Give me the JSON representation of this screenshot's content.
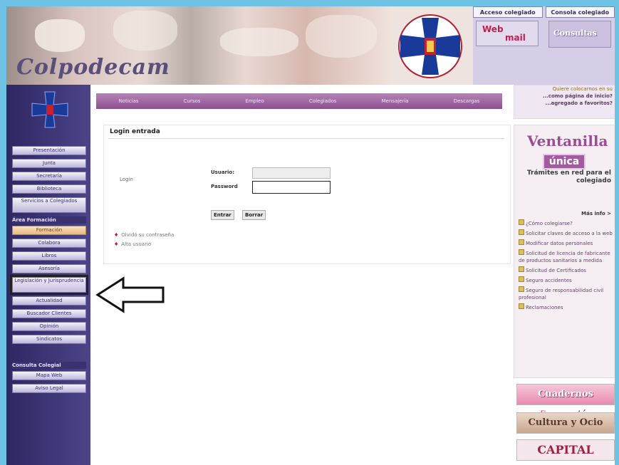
{
  "header": {
    "logo_text": "Colpodecam",
    "access_links": [
      "Acceso colegiado",
      "Consola colegiado"
    ],
    "webmail_label_1": "Web",
    "webmail_label_2": "mail",
    "consulta_label": "Consultas"
  },
  "sidebar": {
    "items": [
      "Presentación",
      "Junta",
      "Secretaría",
      "Biblioteca",
      "Servicios a Colegiados"
    ],
    "section_heading": "Área Formación",
    "items2": [
      "Formación",
      "Colabora",
      "Libros",
      "Asesoría",
      "Legislación y Jurisprudencia",
      "Actualidad",
      "Buscador Clientes",
      "Opinión",
      "Sindicatos"
    ],
    "section_heading2": "Consulta Colegial",
    "items3": [
      "Mapa Web",
      "Aviso Legal"
    ]
  },
  "menu": {
    "items": [
      "Noticias",
      "Cursos",
      "Empleo",
      "Colegiados",
      "Mensajería",
      "Descargas"
    ]
  },
  "login": {
    "title": "Login entrada",
    "side_label": "Login",
    "username_label": "Usuario:",
    "password_label": "Password",
    "submit_label": "Entrar",
    "reset_label": "Borrar",
    "forgot_link": "Olvidó su contraseña",
    "register_link": "Alta usuario"
  },
  "right": {
    "top_lines": [
      "Quiere colocarnos en su",
      "...como página de inicio?",
      "...agregado a favoritos?"
    ],
    "ventanilla_title": "Ventanilla",
    "ventanilla_badge": "única",
    "ventanilla_caption": "Trámites en red para el colegiado",
    "more_link": "Más info >",
    "items": [
      "¿Cómo colegiarse?",
      "Solicitar claves de acceso a la web",
      "Modificar datos personales",
      "Solicitud de licencia de fabricante de productos sanitarios a medida",
      "Solicitud de Certificados",
      "Seguro accidentes",
      "Seguro de responsabilidad civil profesional",
      "Reclamaciones"
    ],
    "promo1": "Cuadernos Formación",
    "promo2": "Cultura y Ocio",
    "promo3": "CAPITAL DENTAL"
  },
  "colors": {
    "page_border": "#6fc4e6",
    "sidebar_bg": "#3a3270",
    "menubar": "#8a4f8e",
    "accent": "#a35a9f"
  }
}
